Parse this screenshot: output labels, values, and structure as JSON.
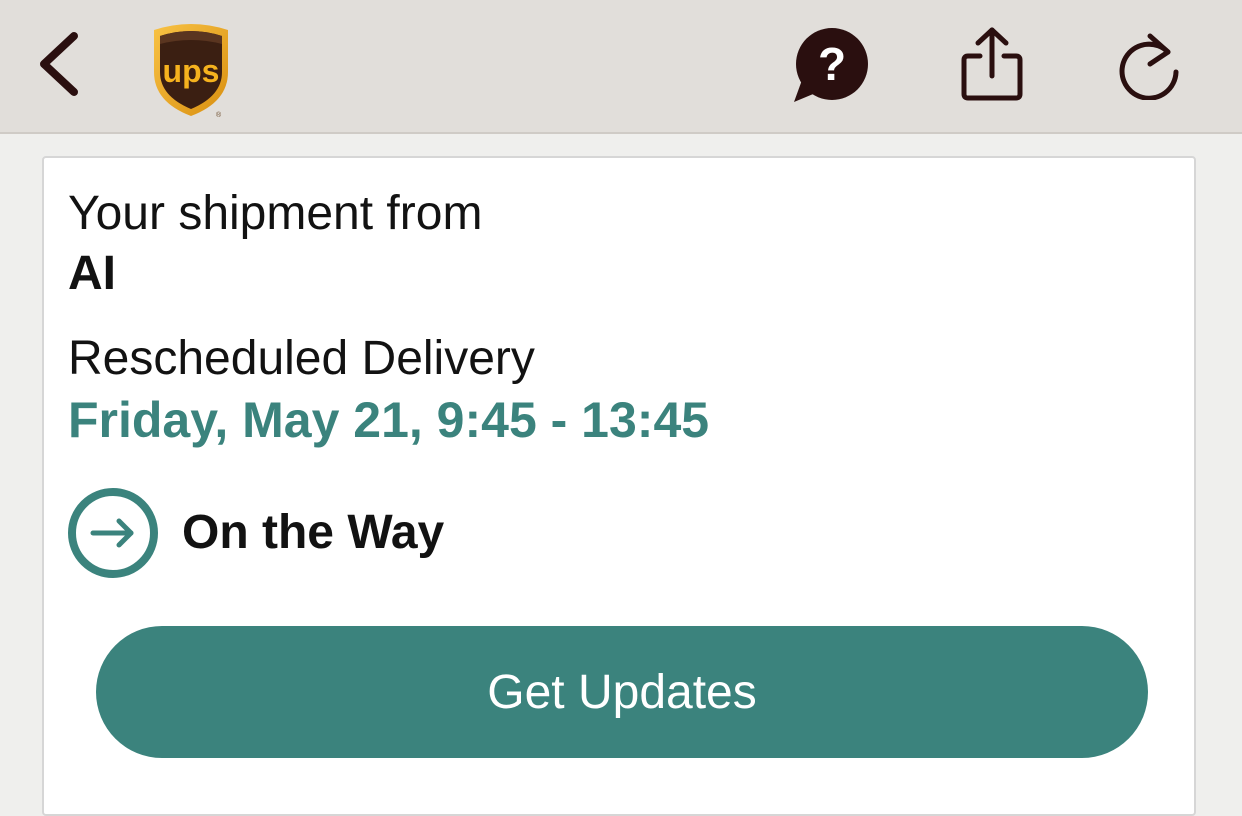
{
  "header": {
    "back_icon": "chevron-left-icon",
    "logo_text": "ups",
    "help_icon": "help-bubble-icon",
    "share_icon": "share-icon",
    "refresh_icon": "refresh-icon"
  },
  "shipment": {
    "from_label": "Your shipment from",
    "shipper": "AI",
    "delivery_label": "Rescheduled Delivery",
    "delivery_date": "Friday, May 21, 9:45 - 13:45",
    "status": "On the Way",
    "status_icon": "arrow-right-circle-icon"
  },
  "actions": {
    "get_updates_label": "Get Updates"
  },
  "colors": {
    "accent": "#3b837d",
    "header_bg": "#e1deda",
    "icon_dark": "#2a0f0f",
    "ups_brown": "#3b1f12",
    "ups_gold": "#f5b21e"
  }
}
